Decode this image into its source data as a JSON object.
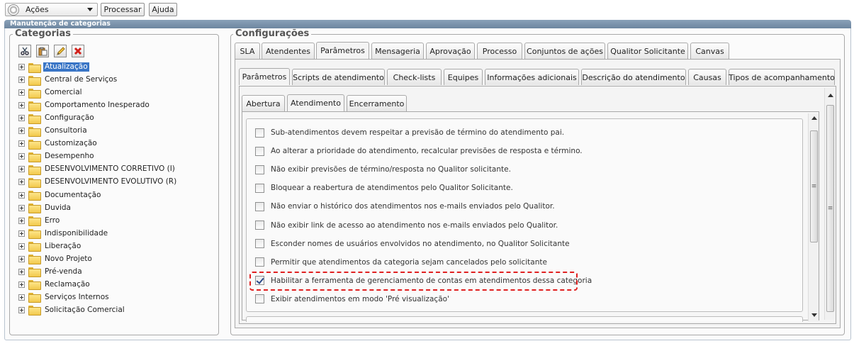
{
  "toolbar": {
    "actions_select": "Ações",
    "process_button": "Processar",
    "help_button": "Ajuda"
  },
  "window": {
    "title": "Manutenção de categorias"
  },
  "categories": {
    "legend": "Categorias",
    "items": [
      {
        "label": "Atualização",
        "selected": true
      },
      {
        "label": "Central de Serviços"
      },
      {
        "label": "Comercial"
      },
      {
        "label": "Comportamento Inesperado"
      },
      {
        "label": "Configuração"
      },
      {
        "label": "Consultoria"
      },
      {
        "label": "Customização"
      },
      {
        "label": "Desempenho"
      },
      {
        "label": "DESENVOLVIMENTO CORRETIVO (I)"
      },
      {
        "label": "DESENVOLVIMENTO EVOLUTIVO (R)"
      },
      {
        "label": "Documentação"
      },
      {
        "label": "Duvida"
      },
      {
        "label": "Erro"
      },
      {
        "label": "Indisponibilidade"
      },
      {
        "label": "Liberação"
      },
      {
        "label": "Novo Projeto"
      },
      {
        "label": "Pré-venda"
      },
      {
        "label": "Reclamação"
      },
      {
        "label": "Serviços Internos"
      },
      {
        "label": "Solicitação Comercial"
      }
    ]
  },
  "config": {
    "legend": "Configurações",
    "tabs1": [
      "SLA",
      "Atendentes",
      "Parâmetros",
      "Mensageria",
      "Aprovação",
      "Processo",
      "Conjuntos de ações",
      "Qualitor Solicitante",
      "Canvas"
    ],
    "tabs2": [
      "Parâmetros",
      "Scripts de atendimento",
      "Check-lists",
      "Equipes",
      "Informações adicionais",
      "Descrição do atendimento",
      "Causas",
      "Tipos de acompanhamento"
    ],
    "tabs3": [
      "Abertura",
      "Atendimento",
      "Encerramento"
    ],
    "options": [
      {
        "label": "Sub-atendimentos devem respeitar a previsão de término do atendimento pai.",
        "checked": false
      },
      {
        "label": "Ao alterar a prioridade do atendimento, recalcular previsões de resposta e término.",
        "checked": false
      },
      {
        "label": "Não exibir previsões de término/resposta no Qualitor solicitante.",
        "checked": false
      },
      {
        "label": "Bloquear a reabertura de atendimentos pelo Qualitor Solicitante.",
        "checked": false
      },
      {
        "label": "Não enviar o histórico dos atendimentos nos e-mails enviados pelo Qualitor.",
        "checked": false
      },
      {
        "label": "Não exibir link de acesso ao atendimento nos e-mails enviados pelo Qualitor.",
        "checked": false
      },
      {
        "label": "Esconder nomes de usuários envolvidos no atendimento, no Qualitor Solicitante",
        "checked": false
      },
      {
        "label": "Permitir que atendimentos da categoria sejam cancelados pelo solicitante",
        "checked": false
      },
      {
        "label": "Habilitar a ferramenta de gerenciamento de contas em atendimentos dessa categoria",
        "checked": true
      },
      {
        "label": "Exibir atendimentos em modo 'Pré visualização'",
        "checked": false
      }
    ]
  },
  "colors": {
    "titlebar": "#7a92aa",
    "selection": "#3975c6",
    "highlight_border": "#e02020"
  }
}
